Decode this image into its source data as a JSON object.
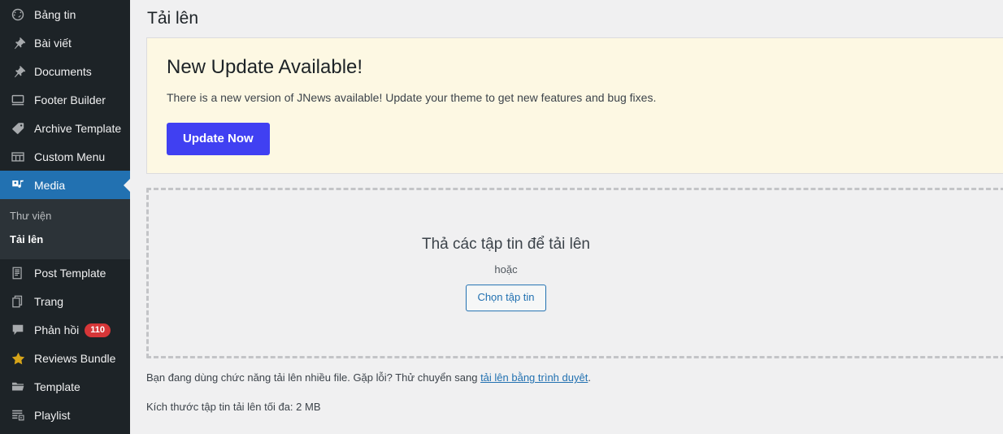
{
  "colors": {
    "sidebar_bg": "#1d2327",
    "submenu_bg": "#2c3338",
    "current_blue": "#2271b1",
    "link_blue": "#2271b1",
    "update_button": "#4040f2",
    "notice_bg": "#fdf8e3",
    "badge_red": "#d63638",
    "star_gold": "#d6a419",
    "page_bg": "#f0f0f1",
    "dash_border": "#c3c4c7"
  },
  "sidebar": {
    "items": [
      {
        "label": "Bảng tin",
        "icon": "dashboard-icon",
        "name": "sidebar-item-dashboard",
        "current": false
      },
      {
        "label": "Bài viết",
        "icon": "pin-icon",
        "name": "sidebar-item-posts",
        "current": false
      },
      {
        "label": "Documents",
        "icon": "pin-icon",
        "name": "sidebar-item-documents",
        "current": false
      },
      {
        "label": "Footer Builder",
        "icon": "screen-icon",
        "name": "sidebar-item-footer-builder",
        "current": false
      },
      {
        "label": "Archive Template",
        "icon": "tag-icon",
        "name": "sidebar-item-archive-template",
        "current": false
      },
      {
        "label": "Custom Menu",
        "icon": "grid-icon",
        "name": "sidebar-item-custom-menu",
        "current": false
      },
      {
        "label": "Media",
        "icon": "media-icon",
        "name": "sidebar-item-media",
        "current": true
      },
      {
        "label": "Post Template",
        "icon": "document-icon",
        "name": "sidebar-item-post-template",
        "current": false
      },
      {
        "label": "Trang",
        "icon": "pages-icon",
        "name": "sidebar-item-pages",
        "current": false
      },
      {
        "label": "Phản hồi",
        "icon": "comment-icon",
        "name": "sidebar-item-comments",
        "current": false,
        "badge": "110"
      },
      {
        "label": "Reviews Bundle",
        "icon": "star-icon",
        "name": "sidebar-item-reviews-bundle",
        "current": false
      },
      {
        "label": "Template",
        "icon": "folder-icon",
        "name": "sidebar-item-template",
        "current": false
      },
      {
        "label": "Playlist",
        "icon": "playlist-icon",
        "name": "sidebar-item-playlist",
        "current": false
      }
    ],
    "media_submenu": [
      {
        "label": "Thư viện",
        "name": "submenu-item-library",
        "current": false
      },
      {
        "label": "Tải lên",
        "name": "submenu-item-upload",
        "current": true
      }
    ]
  },
  "main": {
    "page_title": "Tải lên",
    "notice": {
      "heading": "New Update Available!",
      "body": "There is a new version of JNews available! Update your theme to get new features and bug fixes.",
      "button_label": "Update Now"
    },
    "dropzone": {
      "title": "Thả các tập tin để tải lên",
      "or": "hoặc",
      "button_label": "Chọn tập tin"
    },
    "footer": {
      "multifile_prefix": "Bạn đang dùng chức năng tải lên nhiều file. Gặp lỗi? Thử chuyển sang ",
      "browser_link": "tải lên bằng trình duyệt",
      "multifile_suffix": ".",
      "max_size": "Kích thước tập tin tải lên tối đa: 2 MB"
    }
  }
}
